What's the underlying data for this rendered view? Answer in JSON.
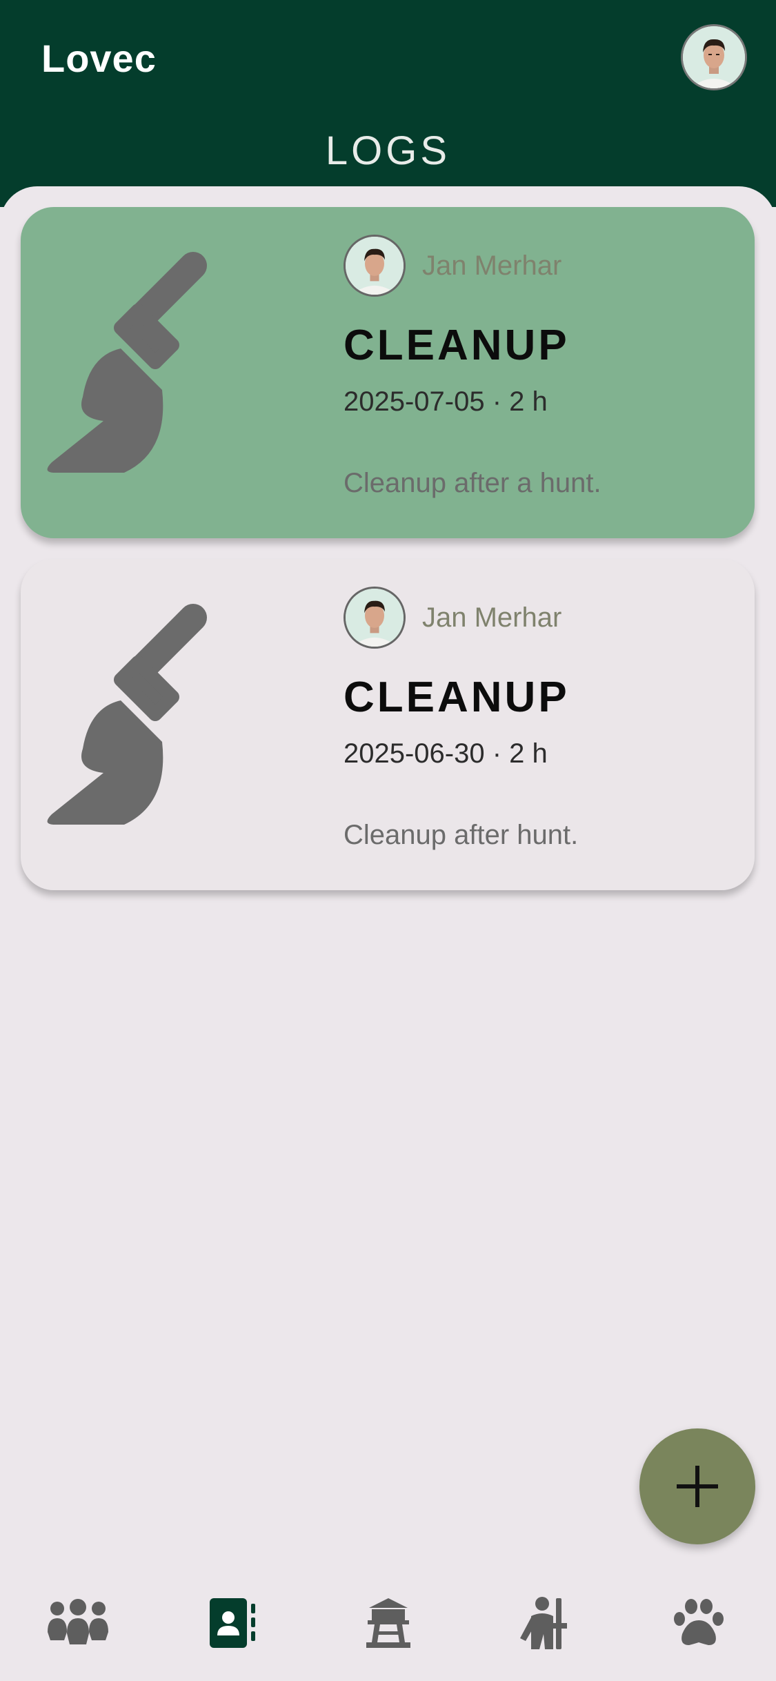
{
  "app": {
    "title": "Lovec"
  },
  "page": {
    "heading": "LOGS"
  },
  "logs": [
    {
      "author": "Jan Merhar",
      "type": "CLEANUP",
      "meta": "2025-07-05 · 2 h",
      "description": "Cleanup after a hunt.",
      "icon": "broom-icon",
      "highlighted": true
    },
    {
      "author": "Jan Merhar",
      "type": "CLEANUP",
      "meta": "2025-06-30 · 2 h",
      "description": "Cleanup after hunt.",
      "icon": "broom-icon",
      "highlighted": false
    }
  ],
  "fab": {
    "icon": "plus-icon"
  },
  "bottom_nav": [
    {
      "icon": "group-icon",
      "active": false
    },
    {
      "icon": "contacts-book-icon",
      "active": true
    },
    {
      "icon": "watchtower-icon",
      "active": false
    },
    {
      "icon": "hunter-icon",
      "active": false
    },
    {
      "icon": "paw-icon",
      "active": false
    }
  ],
  "colors": {
    "header": "#043d2c",
    "background": "#ece7eb",
    "highlight_card": "#81b290",
    "fab": "#7a855c",
    "icon_gray": "#6b6b6b"
  }
}
